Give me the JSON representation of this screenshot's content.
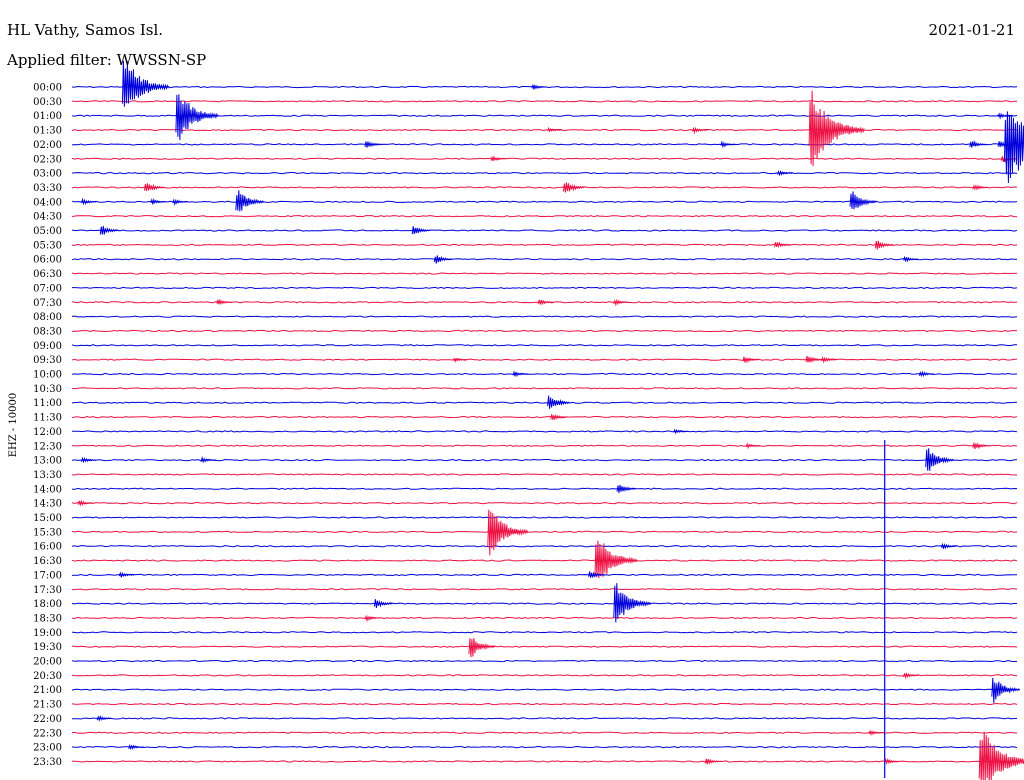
{
  "header": {
    "station": "HL Vathy, Samos Isl.",
    "filter": "Applied filter: WWSSN-SP",
    "date": "2021-01-21"
  },
  "colors": {
    "trace_a": "#0000dd",
    "trace_b": "#ee1144",
    "text": "#000000"
  },
  "chart_data": {
    "type": "helicorder",
    "title": "HL Vathy, Samos Isl.",
    "ylabel": "EHZ - 10000",
    "date": "2021-01-21",
    "row_labels": [
      "00:00",
      "00:30",
      "01:00",
      "01:30",
      "02:00",
      "02:30",
      "03:00",
      "03:30",
      "04:00",
      "04:30",
      "05:00",
      "05:30",
      "06:00",
      "06:30",
      "07:00",
      "07:30",
      "08:00",
      "08:30",
      "09:00",
      "09:30",
      "10:00",
      "10:30",
      "11:00",
      "11:30",
      "12:00",
      "12:30",
      "13:00",
      "13:30",
      "14:00",
      "14:30",
      "15:00",
      "15:30",
      "16:00",
      "16:30",
      "17:00",
      "17:30",
      "18:00",
      "18:30",
      "19:00",
      "19:30",
      "20:00",
      "20:30",
      "21:00",
      "21:30",
      "22:00",
      "22:30",
      "23:00",
      "23:30"
    ],
    "series_colors_alternating": [
      "#0000dd",
      "#ee1144"
    ],
    "events": [
      {
        "row": 0,
        "minute": 1.6,
        "amp": 38
      },
      {
        "row": 0,
        "minute": 14.6,
        "amp": 4
      },
      {
        "row": 2,
        "minute": 3.3,
        "amp": 34
      },
      {
        "row": 3,
        "minute": 23.4,
        "amp": 48
      },
      {
        "row": 3,
        "minute": 19.7,
        "amp": 4
      },
      {
        "row": 4,
        "minute": 9.3,
        "amp": 6
      },
      {
        "row": 4,
        "minute": 28.5,
        "amp": 6
      },
      {
        "row": 4,
        "minute": 29.4,
        "amp": 5
      },
      {
        "row": 4,
        "minute": 20.6,
        "amp": 4
      },
      {
        "row": 5,
        "minute": 13.3,
        "amp": 4
      },
      {
        "row": 3,
        "minute": 15.1,
        "amp": 3
      },
      {
        "row": 6,
        "minute": 22.4,
        "amp": 4
      },
      {
        "row": 7,
        "minute": 2.3,
        "amp": 9
      },
      {
        "row": 7,
        "minute": 15.6,
        "amp": 10
      },
      {
        "row": 8,
        "minute": 24.7,
        "amp": 16
      },
      {
        "row": 8,
        "minute": 3.2,
        "amp": 4
      },
      {
        "row": 8,
        "minute": 0.3,
        "amp": 4
      },
      {
        "row": 8,
        "minute": 2.5,
        "amp": 4
      },
      {
        "row": 8,
        "minute": 5.2,
        "amp": 18
      },
      {
        "row": 7,
        "minute": 28.6,
        "amp": 4
      },
      {
        "row": 2,
        "minute": 29.4,
        "amp": 4
      },
      {
        "row": 5,
        "minute": 29.5,
        "amp": 5
      },
      {
        "row": 4,
        "minute": 29.6,
        "amp": 55
      },
      {
        "row": 10,
        "minute": 0.9,
        "amp": 8
      },
      {
        "row": 10,
        "minute": 10.8,
        "amp": 7
      },
      {
        "row": 11,
        "minute": 22.3,
        "amp": 5
      },
      {
        "row": 11,
        "minute": 25.5,
        "amp": 7
      },
      {
        "row": 12,
        "minute": 11.5,
        "amp": 7
      },
      {
        "row": 12,
        "minute": 26.4,
        "amp": 4
      },
      {
        "row": 14,
        "minute": 30.4,
        "amp": 5
      },
      {
        "row": 15,
        "minute": 4.6,
        "amp": 4
      },
      {
        "row": 15,
        "minute": 14.8,
        "amp": 4
      },
      {
        "row": 15,
        "minute": 17.2,
        "amp": 4
      },
      {
        "row": 15,
        "minute": 33.9,
        "amp": 8
      },
      {
        "row": 17,
        "minute": 31.5,
        "amp": 8
      },
      {
        "row": 19,
        "minute": 21.3,
        "amp": 5
      },
      {
        "row": 19,
        "minute": 23.3,
        "amp": 6
      },
      {
        "row": 19,
        "minute": 23.8,
        "amp": 4
      },
      {
        "row": 19,
        "minute": 12.1,
        "amp": 3
      },
      {
        "row": 20,
        "minute": 30.7,
        "amp": 7
      },
      {
        "row": 20,
        "minute": 26.9,
        "amp": 4
      },
      {
        "row": 20,
        "minute": 14.0,
        "amp": 4
      },
      {
        "row": 21,
        "minute": 36.0,
        "amp": 4
      },
      {
        "row": 22,
        "minute": 15.1,
        "amp": 12
      },
      {
        "row": 23,
        "minute": 15.2,
        "amp": 5
      },
      {
        "row": 24,
        "minute": 42.3,
        "amp": 12
      },
      {
        "row": 24,
        "minute": 19.1,
        "amp": 3
      },
      {
        "row": 25,
        "minute": 28.6,
        "amp": 6
      },
      {
        "row": 25,
        "minute": 21.4,
        "amp": 3
      },
      {
        "row": 26,
        "minute": 27.1,
        "amp": 18
      },
      {
        "row": 26,
        "minute": 0.3,
        "amp": 4
      },
      {
        "row": 26,
        "minute": 4.1,
        "amp": 4
      },
      {
        "row": 26,
        "minute": 39.3,
        "amp": 3
      },
      {
        "row": 28,
        "minute": 17.3,
        "amp": 8
      },
      {
        "row": 28,
        "minute": 41.9,
        "amp": 8
      },
      {
        "row": 29,
        "minute": 0.2,
        "amp": 4
      },
      {
        "row": 31,
        "minute": 13.2,
        "amp": 32
      },
      {
        "row": 32,
        "minute": 27.6,
        "amp": 4
      },
      {
        "row": 33,
        "minute": 16.6,
        "amp": 34
      },
      {
        "row": 34,
        "minute": 1.5,
        "amp": 4
      },
      {
        "row": 34,
        "minute": 16.4,
        "amp": 6
      },
      {
        "row": 36,
        "minute": 17.2,
        "amp": 28
      },
      {
        "row": 36,
        "minute": 9.6,
        "amp": 7
      },
      {
        "row": 37,
        "minute": 9.3,
        "amp": 4
      },
      {
        "row": 38,
        "minute": 30.8,
        "amp": 4
      },
      {
        "row": 39,
        "minute": 12.6,
        "amp": 16
      },
      {
        "row": 41,
        "minute": 26.4,
        "amp": 4
      },
      {
        "row": 42,
        "minute": 29.2,
        "amp": 18
      },
      {
        "row": 44,
        "minute": 0.8,
        "amp": 4
      },
      {
        "row": 45,
        "minute": 25.3,
        "amp": 4
      },
      {
        "row": 45,
        "minute": 37.2,
        "amp": 4
      },
      {
        "row": 45,
        "minute": 38.0,
        "amp": 4
      },
      {
        "row": 46,
        "minute": 1.8,
        "amp": 4
      },
      {
        "row": 47,
        "minute": 20.1,
        "amp": 5
      },
      {
        "row": 47,
        "minute": 25.8,
        "amp": 4
      },
      {
        "row": 47,
        "minute": 35.0,
        "amp": 4
      },
      {
        "row": 47,
        "minute": 28.8,
        "amp": 44
      }
    ],
    "tall_spikes": [
      {
        "row": 3,
        "minute": 39.4,
        "up": 110,
        "down": 200
      },
      {
        "row": 26,
        "minute": 25.8,
        "up": 20,
        "down": 320
      }
    ]
  }
}
